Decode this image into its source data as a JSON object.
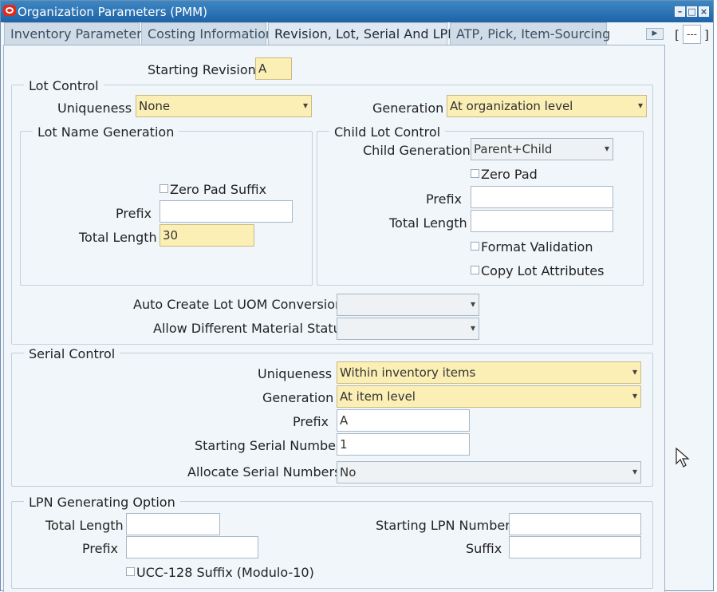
{
  "window": {
    "title": "Organization Parameters (PMM)",
    "controls": [
      "minimize",
      "maximize",
      "close"
    ]
  },
  "tabs": [
    {
      "label": "Inventory Parameters",
      "active": false
    },
    {
      "label": "Costing Information",
      "active": false
    },
    {
      "label": "Revision, Lot, Serial And LPN",
      "active": true
    },
    {
      "label": "ATP, Pick, Item-Sourcing",
      "active": false
    }
  ],
  "tab_nav": {
    "open_bracket": "[",
    "value": "---",
    "close_bracket": "]"
  },
  "revision": {
    "label": "Starting Revision",
    "value": "A"
  },
  "lot_control": {
    "legend": "Lot Control",
    "uniqueness_label": "Uniqueness",
    "uniqueness_value": "None",
    "generation_label": "Generation",
    "generation_value": "At organization level",
    "lot_name_generation": {
      "legend": "Lot Name Generation",
      "zero_pad_suffix": "Zero Pad Suffix",
      "prefix_label": "Prefix",
      "prefix_value": "",
      "total_length_label": "Total Length",
      "total_length_value": "30"
    },
    "child_lot_control": {
      "legend": "Child Lot Control",
      "child_generation_label": "Child Generation",
      "child_generation_value": "Parent+Child",
      "zero_pad": "Zero Pad",
      "prefix_label": "Prefix",
      "prefix_value": "",
      "total_length_label": "Total Length",
      "total_length_value": "",
      "format_validation": "Format Validation",
      "copy_lot_attributes": "Copy Lot Attributes"
    },
    "auto_create_label": "Auto Create Lot UOM Conversion",
    "auto_create_value": "",
    "allow_diff_label": "Allow Different Material Status",
    "allow_diff_value": ""
  },
  "serial_control": {
    "legend": "Serial Control",
    "uniqueness_label": "Uniqueness",
    "uniqueness_value": "Within inventory items",
    "generation_label": "Generation",
    "generation_value": "At item level",
    "prefix_label": "Prefix",
    "prefix_value": "A",
    "starting_label": "Starting Serial Number",
    "starting_value": "1",
    "allocate_label": "Allocate Serial Numbers",
    "allocate_value": "No"
  },
  "lpn": {
    "legend": "LPN Generating Option",
    "total_length_label": "Total Length",
    "total_length_value": "",
    "prefix_label": "Prefix",
    "prefix_value": "",
    "starting_label": "Starting LPN Number",
    "starting_value": "",
    "suffix_label": "Suffix",
    "suffix_value": "",
    "ucc_label": "UCC-128 Suffix (Modulo-10)"
  },
  "colors": {
    "title_bar": "#2a72b5",
    "required_field": "#fbefb5",
    "panel_bg": "#f1f6fa"
  }
}
